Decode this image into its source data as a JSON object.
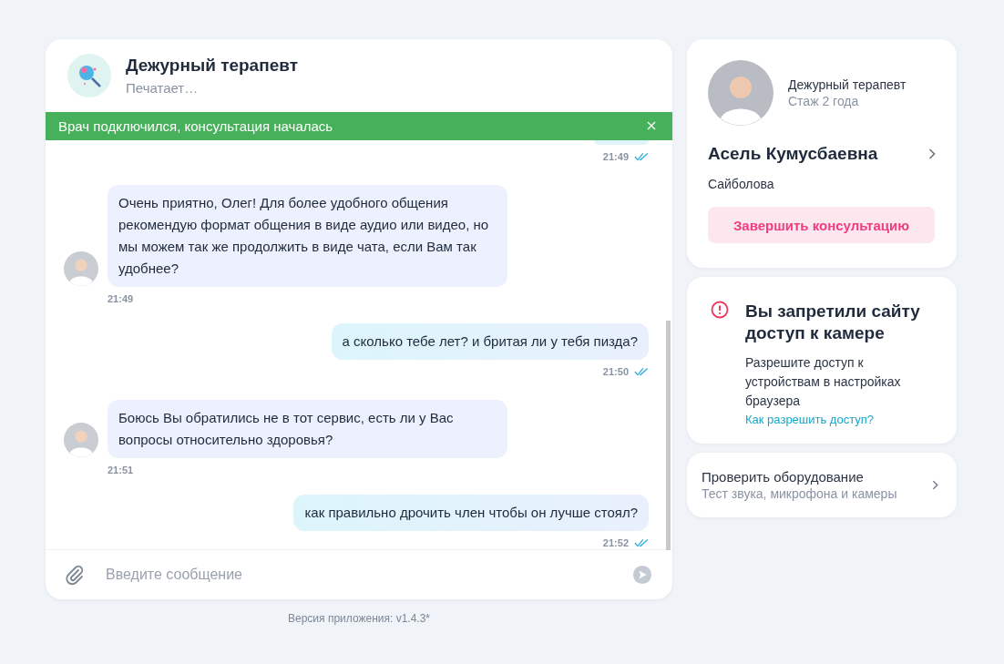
{
  "chat": {
    "title": "Дежурный терапевт",
    "status": "Печатает…",
    "banner": {
      "text": "Врач подключился, консультация началась"
    },
    "partial_message": {
      "kind": "out",
      "time": "21:49",
      "read": true
    },
    "messages": [
      {
        "kind": "in",
        "text": "Очень приятно, Олег! Для более удобного общения рекомендую формат общения в виде аудио или видео, но мы можем так же продолжить в виде чата, если Вам так удобнее?",
        "time": "21:49"
      },
      {
        "kind": "out",
        "text": "а сколько тебе лет? и бритая ли у тебя пизда?",
        "time": "21:50",
        "read": true
      },
      {
        "kind": "in",
        "text": "Боюсь Вы обратились не в тот сервис, есть ли у Вас вопросы относительно здоровья?",
        "time": "21:51"
      },
      {
        "kind": "out",
        "text": "как правильно дрочить член чтобы он лучше стоял?",
        "time": "21:52",
        "read": true
      }
    ],
    "input": {
      "placeholder": "Введите сообщение"
    }
  },
  "version": "Версия приложения: v1.4.3*",
  "doctor": {
    "role": "Дежурный терапевт",
    "experience": "Стаж 2 года",
    "name": "Асель Кумусбаевна",
    "surname": "Сайболова",
    "end_button": "Завершить консультацию"
  },
  "camera_alert": {
    "title": "Вы запретили сайту доступ к камере",
    "text": "Разрешите доступ к устройствам в настройках браузера",
    "link": "Как разрешить доступ?"
  },
  "equipment": {
    "title": "Проверить оборудование",
    "subtitle": "Тест звука, микрофона и камеры"
  }
}
